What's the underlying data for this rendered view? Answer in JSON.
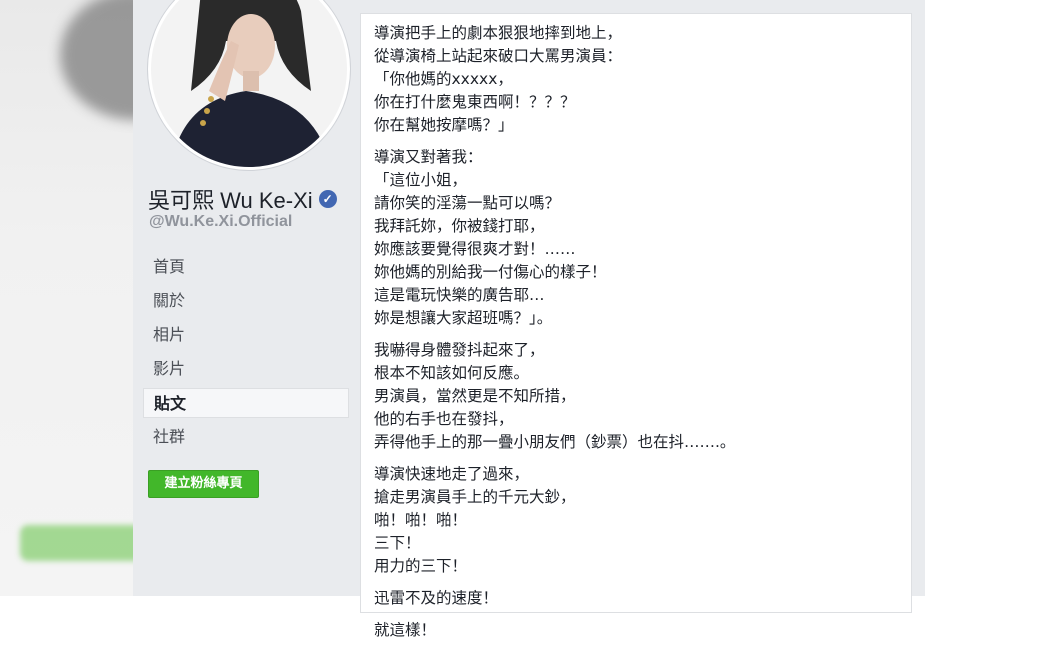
{
  "profile": {
    "name": "吳可熙 Wu Ke-Xi",
    "handle": "@Wu.Ke.Xi.Official",
    "verified_icon": "verified-check-icon"
  },
  "nav": {
    "items": [
      {
        "label": "首頁"
      },
      {
        "label": "關於"
      },
      {
        "label": "相片"
      },
      {
        "label": "影片"
      },
      {
        "label": "貼文"
      },
      {
        "label": "社群"
      }
    ],
    "active_index": 4
  },
  "create_page_button": "建立粉絲專頁",
  "post": {
    "paragraphs": [
      {
        "lines": [
          "導演把手上的劇本狠狠地摔到地上，",
          "從導演椅上站起來破口大罵男演員：",
          "「你他媽的xxxxx，",
          "你在打什麼鬼東西啊！？？？",
          "你在幫她按摩嗎？」"
        ]
      },
      {
        "lines": [
          "導演又對著我：",
          "「這位小姐，",
          "請你笑的淫蕩一點可以嗎？",
          "我拜託妳，你被錢打耶，",
          "妳應該要覺得很爽才對！……",
          "妳他媽的別給我一付傷心的樣子！",
          "這是電玩快樂的廣告耶…",
          "妳是想讓大家超班嗎？」。"
        ]
      },
      {
        "lines": [
          "我嚇得身體發抖起來了，",
          "根本不知該如何反應。",
          "男演員，當然更是不知所措，",
          "他的右手也在發抖，",
          "弄得他手上的那一疊小朋友們（鈔票）也在抖…….。"
        ]
      },
      {
        "lines": [
          "導演快速地走了過來，",
          "搶走男演員手上的千元大鈔，",
          "啪！啪！啪！",
          "三下！",
          "用力的三下！"
        ]
      },
      {
        "lines": [
          "迅雷不及的速度！"
        ]
      },
      {
        "lines": [
          "就這樣！"
        ]
      }
    ]
  },
  "colors": {
    "fb_bg": "#e9ebee",
    "green_button": "#42b72a",
    "verified_blue": "#4267b2"
  }
}
